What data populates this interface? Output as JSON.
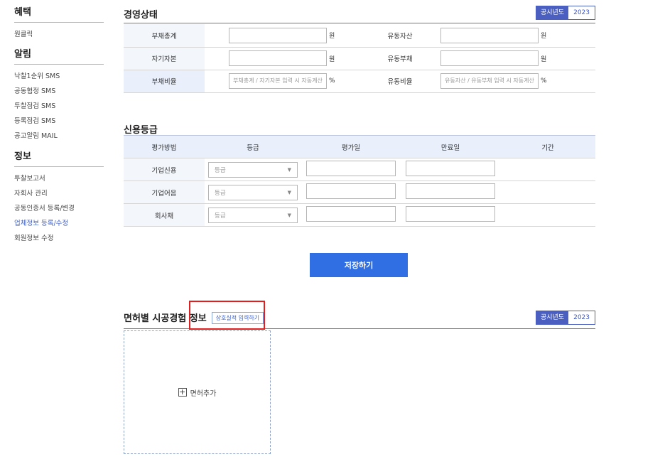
{
  "sidebar": {
    "sections": [
      {
        "title": "혜택",
        "items": [
          "원클릭"
        ]
      },
      {
        "title": "알림",
        "items": [
          "낙찰1순위 SMS",
          "공동협정 SMS",
          "투찰점검 SMS",
          "등록점검 SMS",
          "공고알림 MAIL"
        ]
      },
      {
        "title": "정보",
        "items": [
          "투찰보고서",
          "자회사 관리",
          "공동인증서 등록/변경",
          "업체정보 등록/수정",
          "회원정보 수정"
        ]
      }
    ],
    "active_item": "업체정보 등록/수정"
  },
  "management": {
    "title": "경영상태",
    "year_label": "공시년도",
    "year": "2023",
    "rows": [
      {
        "left_label": "부채총계",
        "left_unit": "원",
        "left_placeholder": "",
        "right_label": "유동자산",
        "right_unit": "원",
        "right_placeholder": ""
      },
      {
        "left_label": "자기자본",
        "left_unit": "원",
        "left_placeholder": "",
        "right_label": "유동부채",
        "right_unit": "원",
        "right_placeholder": ""
      },
      {
        "left_label": "부채비율",
        "left_unit": "%",
        "left_placeholder": "부채총계 / 자기자본 입력 시 자동계산",
        "right_label": "유동비율",
        "right_unit": "%",
        "right_placeholder": "유동자산 / 유동부채 입력 시 자동계산"
      }
    ]
  },
  "credit": {
    "title": "신용등급",
    "headers": [
      "평가방법",
      "등급",
      "평가일",
      "만료일",
      "기간"
    ],
    "rows": [
      {
        "label": "기업신용",
        "grade_placeholder": "등급"
      },
      {
        "label": "기업어음",
        "grade_placeholder": "등급"
      },
      {
        "label": "회사채",
        "grade_placeholder": "등급"
      }
    ]
  },
  "save_label": "저장하기",
  "experience": {
    "title": "면허별 시공경험 정보",
    "input_button": "상호실적 입력하기",
    "year_label": "공시년도",
    "year": "2023",
    "add_label": "면허추가"
  }
}
